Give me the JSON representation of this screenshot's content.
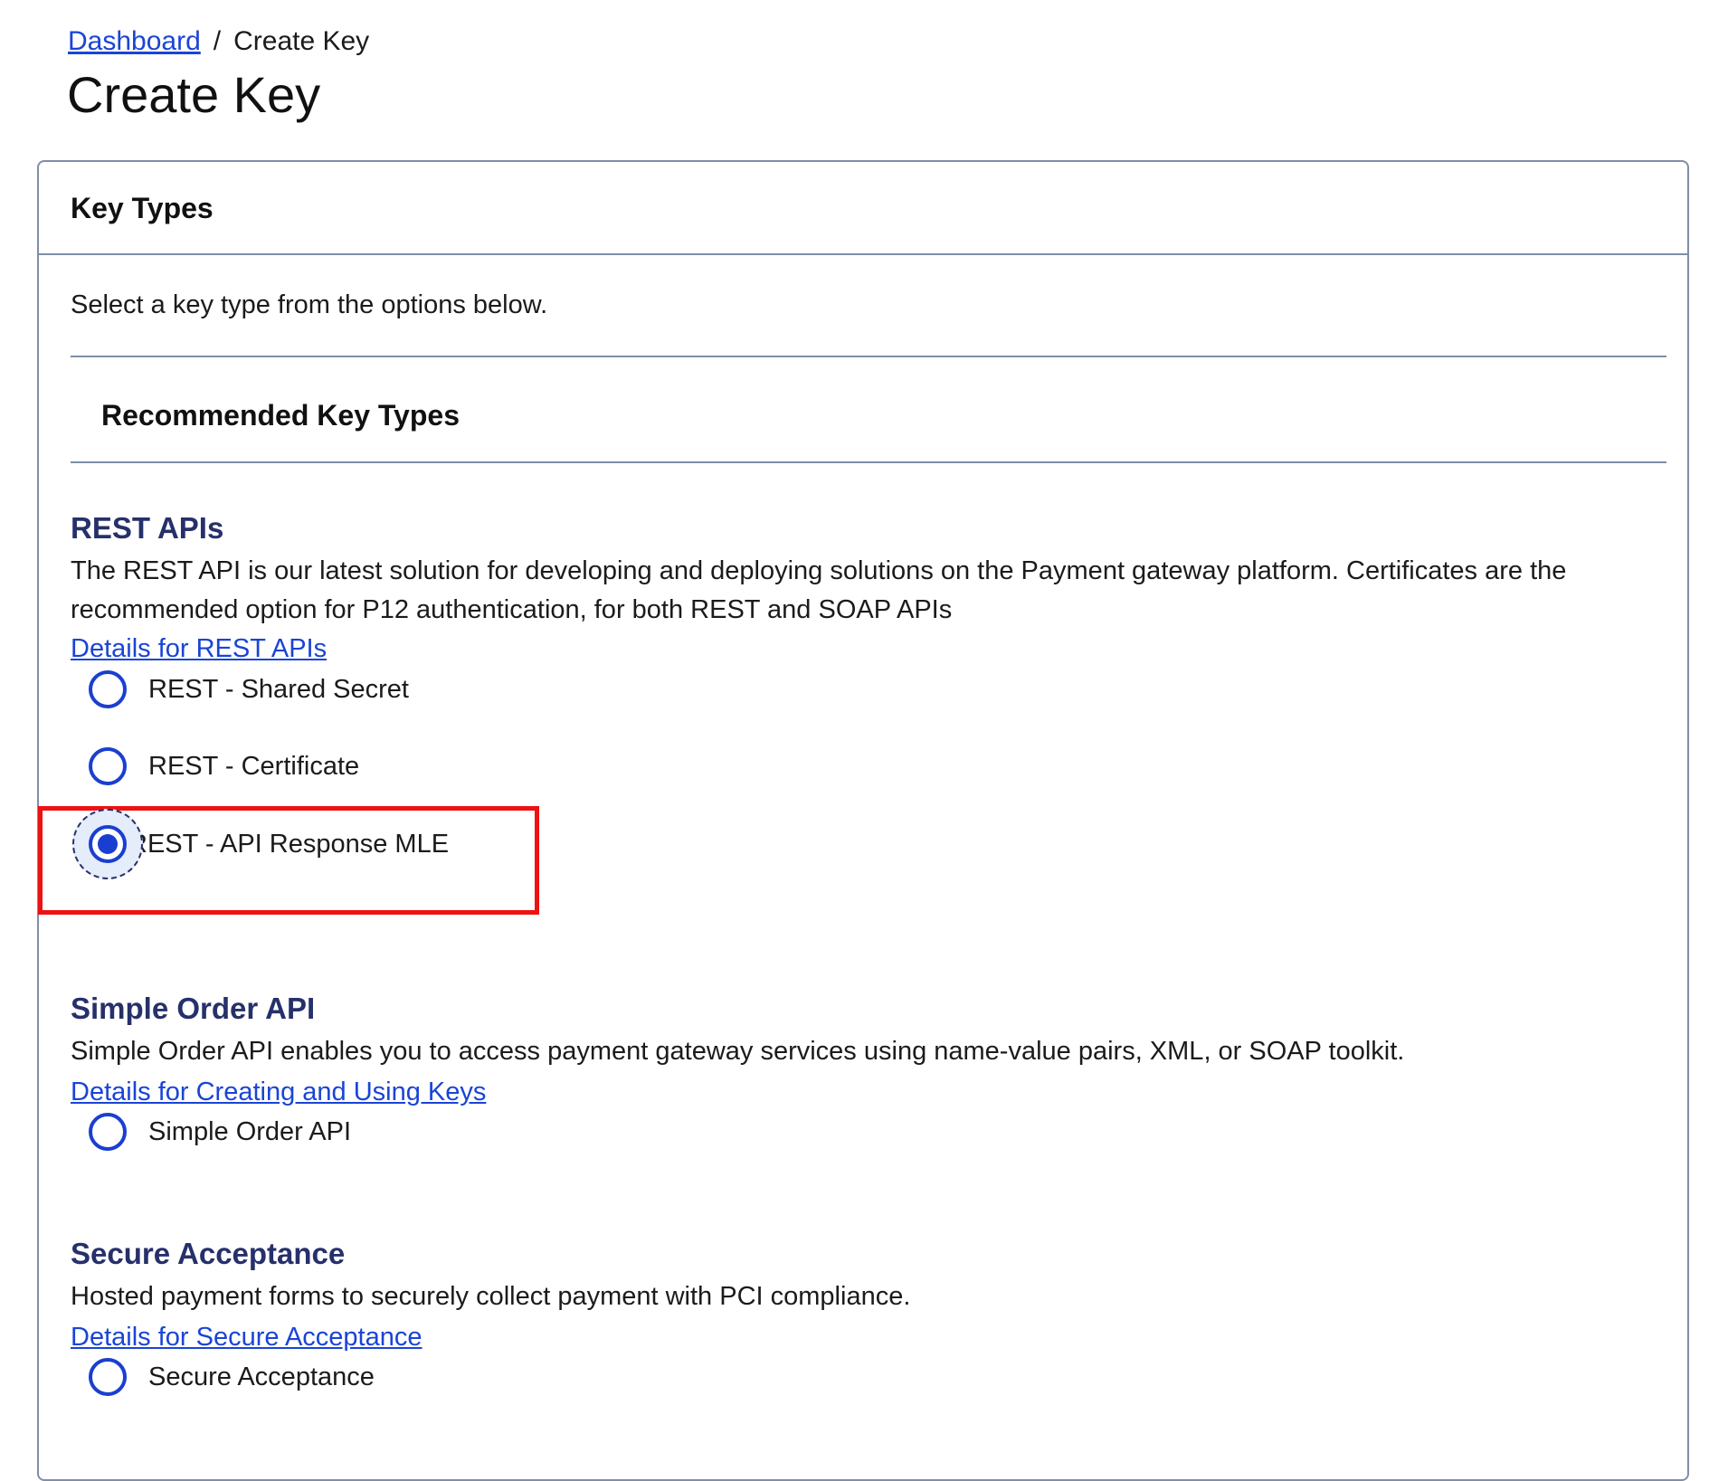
{
  "breadcrumb": {
    "link": "Dashboard",
    "separator": "/",
    "current": "Create Key"
  },
  "page_title": "Create Key",
  "panel": {
    "title": "Key Types",
    "intro": "Select a key type from the options below.",
    "recommended_heading": "Recommended Key Types"
  },
  "sections": {
    "rest": {
      "title": "REST APIs",
      "description": "The REST API is our latest solution for developing and deploying solutions on the Payment gateway platform. Certificates are the recommended option for P12 authentication, for both REST and SOAP APIs",
      "link": "Details for REST APIs",
      "options": [
        {
          "label": "REST - Shared Secret",
          "checked": false
        },
        {
          "label": "REST - Certificate",
          "checked": false
        },
        {
          "label": "REST - API Response MLE",
          "checked": true
        }
      ]
    },
    "simple_order": {
      "title": "Simple Order API",
      "description": "Simple Order API enables you to access payment gateway services using name-value pairs, XML, or SOAP toolkit.",
      "link": "Details for Creating and Using Keys",
      "options": [
        {
          "label": "Simple Order API",
          "checked": false
        }
      ]
    },
    "secure_acceptance": {
      "title": "Secure Acceptance",
      "description": "Hosted payment forms to securely collect payment with PCI compliance.",
      "link": "Details for Secure Acceptance",
      "options": [
        {
          "label": "Secure Acceptance",
          "checked": false
        }
      ]
    }
  },
  "colors": {
    "link": "#1a44d6",
    "radio": "#1a3fd0",
    "section_title": "#26306b",
    "border": "#7f8ea8",
    "highlight": "#ee1111"
  },
  "icons": {
    "radio_unchecked": "radio-unchecked-icon",
    "radio_checked": "radio-checked-icon"
  }
}
